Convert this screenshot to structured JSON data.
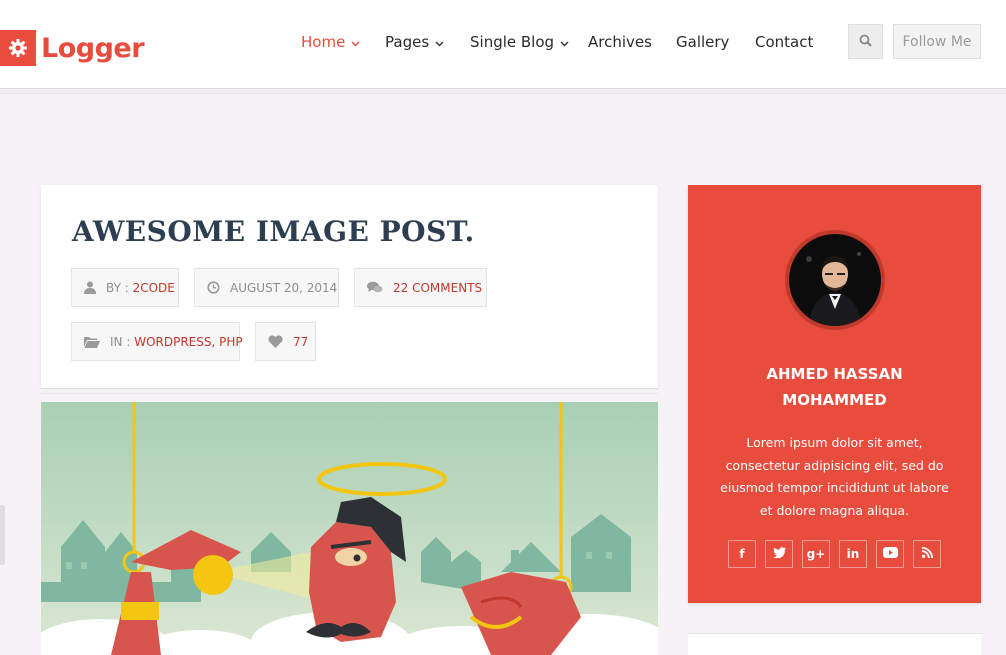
{
  "brand": {
    "name": "Logger",
    "accent": "#e84c3d"
  },
  "nav": {
    "items": [
      {
        "label": "Home",
        "has_dropdown": true,
        "active": true
      },
      {
        "label": "Pages",
        "has_dropdown": true,
        "active": false
      },
      {
        "label": "Single Blog",
        "has_dropdown": true,
        "active": false
      },
      {
        "label": "Archives",
        "has_dropdown": false,
        "active": false
      },
      {
        "label": "Gallery",
        "has_dropdown": false,
        "active": false
      },
      {
        "label": "Contact",
        "has_dropdown": false,
        "active": false
      }
    ],
    "search_icon": "search-icon",
    "follow_label": "Follow Me"
  },
  "post": {
    "title": "AWESOME IMAGE POST.",
    "author_prefix": "BY :",
    "author": "2CODE",
    "date": "AUGUST 20, 2014",
    "comments": "22 COMMENTS",
    "category_prefix": "IN :",
    "category_1": "WORDPRESS",
    "category_sep": ",",
    "category_2": "PHP",
    "likes": "77"
  },
  "author_card": {
    "name_line1": "AHMED HASSAN",
    "name_line2": "MOHAMMED",
    "bio": "Lorem ipsum dolor sit amet, consectetur adipisicing elit, sed do eiusmod tempor incididunt ut labore et dolore magna aliqua.",
    "socials": [
      {
        "icon": "facebook-icon",
        "glyph": "f"
      },
      {
        "icon": "twitter-icon",
        "glyph": "t"
      },
      {
        "icon": "google-plus-icon",
        "glyph": "g+"
      },
      {
        "icon": "linkedin-icon",
        "glyph": "in"
      },
      {
        "icon": "youtube-icon",
        "glyph": "▶"
      },
      {
        "icon": "rss-icon",
        "glyph": "rss"
      }
    ]
  }
}
